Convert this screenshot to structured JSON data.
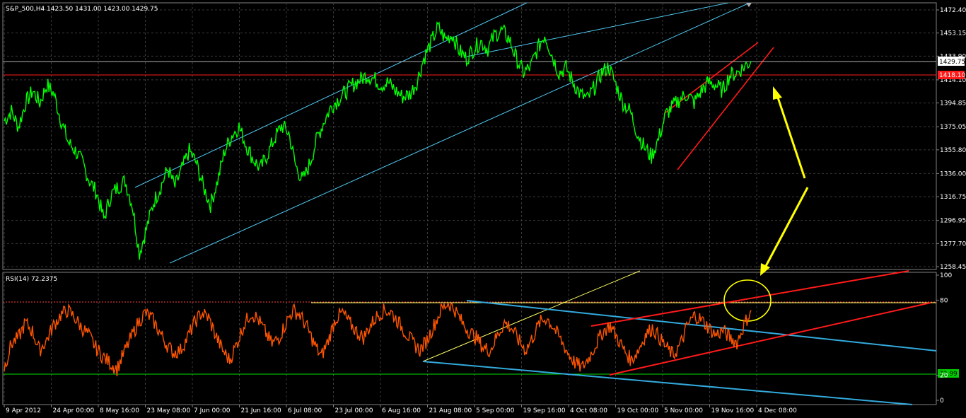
{
  "chart_data": [
    {
      "type": "line",
      "panel": "price",
      "header": "S&P_500,H4  1423.50 1431.00 1423.00 1429.75",
      "symbol": "S&P_500,H4",
      "ohlc": {
        "open": 1423.5,
        "high": 1431.0,
        "low": 1423.0,
        "close": 1429.75
      },
      "ylim": [
        1258.45,
        1472.4
      ],
      "y_ticks": [
        "1472.40",
        "1453.15",
        "1433.90",
        "1414.10",
        "1394.85",
        "1375.05",
        "1355.80",
        "1336.00",
        "1316.75",
        "1296.95",
        "1277.70",
        "1258.45"
      ],
      "current_price_label": "1429.75",
      "red_level": 1418.1,
      "red_level_label": "1418.10",
      "x_tick_labels": [
        "9 Apr 2012",
        "24 Apr 00:00",
        "8 May 16:00",
        "23 May 08:00",
        "7 Jun 00:00",
        "21 Jun 16:00",
        "6 Jul 08:00",
        "23 Jul 00:00",
        "6 Aug 16:00",
        "21 Aug 08:00",
        "5 Sep 00:00",
        "19 Sep 16:00",
        "4 Oct 08:00",
        "19 Oct 00:00",
        "5 Nov 00:00",
        "19 Nov 16:00",
        "4 Dec 08:00"
      ],
      "series": [
        {
          "color": "#00ff00",
          "values": [
            1380,
            1388,
            1375,
            1395,
            1405,
            1395,
            1410,
            1402,
            1380,
            1362,
            1355,
            1345,
            1330,
            1320,
            1298,
            1318,
            1325,
            1330,
            1310,
            1270,
            1290,
            1312,
            1325,
            1340,
            1325,
            1340,
            1355,
            1345,
            1325,
            1310,
            1330,
            1355,
            1368,
            1375,
            1360,
            1348,
            1340,
            1352,
            1365,
            1376,
            1370,
            1342,
            1330,
            1345,
            1366,
            1380,
            1392,
            1398,
            1404,
            1410,
            1414,
            1418,
            1415,
            1410,
            1412,
            1405,
            1400,
            1402,
            1412,
            1432,
            1445,
            1458,
            1448,
            1452,
            1438,
            1432,
            1440,
            1446,
            1440,
            1452,
            1455,
            1448,
            1432,
            1420,
            1425,
            1440,
            1452,
            1435,
            1420,
            1424,
            1412,
            1402,
            1398,
            1408,
            1420,
            1425,
            1410,
            1395,
            1388,
            1370,
            1358,
            1350,
            1365,
            1385,
            1392,
            1398,
            1402,
            1395,
            1405,
            1412,
            1410,
            1405,
            1418,
            1420,
            1425,
            1429.75
          ]
        }
      ],
      "channel_color": "#4fc8f0",
      "wedge_color": "#ff1a1a"
    },
    {
      "type": "line",
      "panel": "indicator",
      "header": "RSI(14) 72.2375",
      "name": "RSI(14)",
      "current_value": 72.2375,
      "ylim": [
        0,
        100
      ],
      "y_ticks": [
        "100",
        "80",
        "20",
        "0"
      ],
      "levels": [
        80,
        20
      ],
      "level_label": "72.99",
      "series": [
        {
          "color": "#ff5500",
          "values": [
            26,
            45,
            50,
            62,
            55,
            40,
            48,
            60,
            68,
            72,
            66,
            58,
            52,
            42,
            35,
            30,
            25,
            38,
            50,
            62,
            70,
            65,
            55,
            45,
            38,
            40,
            50,
            62,
            70,
            66,
            52,
            40,
            32,
            45,
            60,
            70,
            65,
            55,
            45,
            50,
            62,
            72,
            68,
            58,
            45,
            35,
            48,
            65,
            70,
            62,
            55,
            50,
            60,
            68,
            72,
            70,
            62,
            54,
            46,
            40,
            48,
            60,
            72,
            78,
            72,
            62,
            55,
            50,
            42,
            40,
            52,
            62,
            58,
            48,
            40,
            50,
            62,
            66,
            58,
            48,
            38,
            30,
            26,
            34,
            45,
            55,
            60,
            50,
            40,
            32,
            40,
            52,
            58,
            50,
            42,
            36,
            45,
            60,
            68,
            64,
            58,
            52,
            56,
            50,
            46,
            60,
            72
          ]
        }
      ],
      "channel_colors": [
        "#ff1a1a",
        "#33aadd",
        "#ffff66"
      ],
      "circle_color": "#ffff00"
    }
  ],
  "annotation": {
    "arrow_color": "#ffff00"
  }
}
